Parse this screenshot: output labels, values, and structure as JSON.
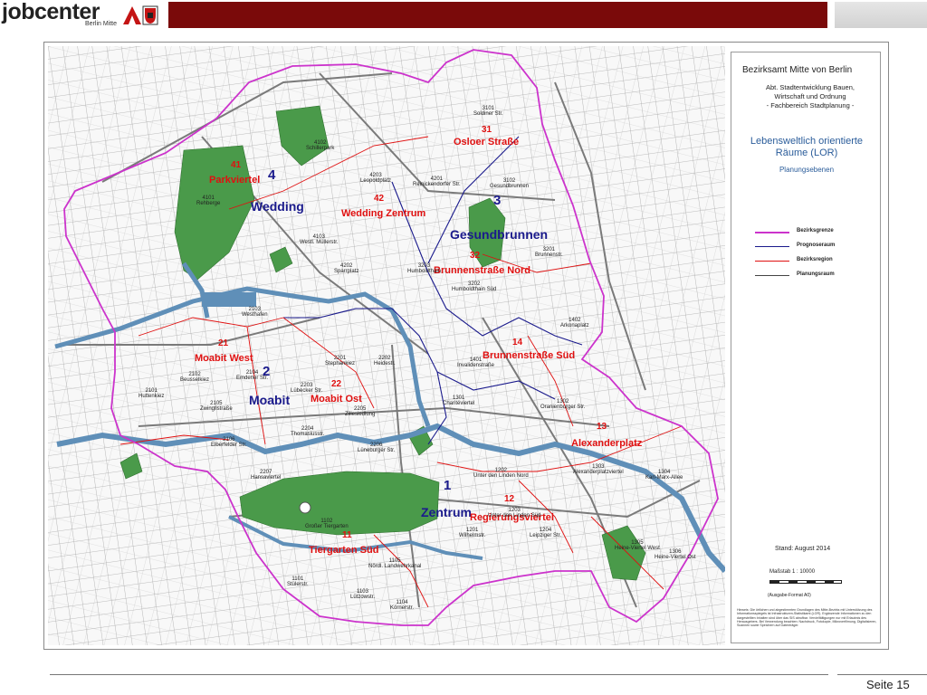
{
  "header": {
    "logo_text": "jobcenter",
    "logo_sub": "Berlin Mitte",
    "colors": {
      "bar": "#7a0a0a",
      "grey": "#d9d9d9"
    }
  },
  "legend": {
    "title": "Bezirksamt Mitte von Berlin",
    "sub_lines": [
      "Abt. Stadtentwicklung Bauen,",
      "Wirtschaft und Ordnung",
      "- Fachbereich Stadtplanung -"
    ],
    "lor_lines": [
      "Lebensweltlich orientierte",
      "Räume (LOR)"
    ],
    "ebenen": "Planungsebenen",
    "items": [
      {
        "label": "Bezirksgrenze",
        "color": "#cc33cc"
      },
      {
        "label": "Prognoseraum",
        "color": "#1a1a8c"
      },
      {
        "label": "Bezirksregion",
        "color": "#e01010"
      },
      {
        "label": "Planungsraum",
        "color": "#444444"
      }
    ],
    "stand": "Stand:   August 2014",
    "massstab": "Maßstab 1 : 10000",
    "format": "(Ausgabe-Format A0)",
    "notes": "Hinweis: Die örtlichen und abgestimmten Grundlagen des Mitte-Bezirks mit Unterstützung des Informationsspiegels ist Infrastrukturen-Statistikamt (LOR). Ergänzende Informationen zu den dargestellten Inhalten sind über das SIS abrufbar. Vervielfältigungen nur mit Erlaubnis des Herausgebers. Bei Verwendung beachten: Nachdruck, Fotokopie, Mikroverfilmung, Digitalisieren, Scannen sowie Speichern auf Datenträger."
  },
  "map": {
    "colors": {
      "park": "#4a9a4a",
      "water": "#5f8fb8",
      "street": "#9a9a9a",
      "boundary": "#cc33cc",
      "prognose": "#1a1a8c",
      "region": "#e01010"
    },
    "prognoseraeume": [
      {
        "num": "1",
        "name": "Zentrum"
      },
      {
        "num": "2",
        "name": "Moabit"
      },
      {
        "num": "3",
        "name": "Gesundbrunnen"
      },
      {
        "num": "4",
        "name": "Wedding"
      }
    ],
    "bezirksregionen": [
      {
        "num": "41",
        "name": "Parkviertel"
      },
      {
        "num": "42",
        "name": "Wedding Zentrum"
      },
      {
        "num": "31",
        "name": "Osloer Straße"
      },
      {
        "num": "32",
        "name": "Brunnenstraße Nord"
      },
      {
        "num": "21",
        "name": "Moabit West"
      },
      {
        "num": "22",
        "name": "Moabit Ost"
      },
      {
        "num": "14",
        "name": "Brunnenstraße Süd"
      },
      {
        "num": "13",
        "name": "Alexanderplatz"
      },
      {
        "num": "12",
        "name": "Regierungsviertel"
      },
      {
        "num": "11",
        "name": "Tiergarten Süd"
      }
    ],
    "planungsraeume": [
      {
        "code": "3101",
        "name": "Soldiner Str."
      },
      {
        "code": "4102",
        "name": "Schillerpark"
      },
      {
        "code": "4203",
        "name": "Leopoldplatz"
      },
      {
        "code": "4201",
        "name": "Reinickendorfer Str."
      },
      {
        "code": "3102",
        "name": "Gesundbrunnen"
      },
      {
        "code": "4101",
        "name": "Rehberge"
      },
      {
        "code": "4103",
        "name": "Westl. Müllerstr."
      },
      {
        "code": "3201",
        "name": "Brunnenstr."
      },
      {
        "code": "4202",
        "name": "Sparrplatz"
      },
      {
        "code": "3203",
        "name": "Humboldthain"
      },
      {
        "code": "3202",
        "name": "Humboldthain Süd"
      },
      {
        "code": "2103",
        "name": "Westhafen"
      },
      {
        "code": "1402",
        "name": "Arkonaplatz"
      },
      {
        "code": "2201",
        "name": "Stephankiez"
      },
      {
        "code": "2202",
        "name": "Heidestr."
      },
      {
        "code": "1401",
        "name": "Invalidenstraße"
      },
      {
        "code": "2102",
        "name": "Beusselkiez"
      },
      {
        "code": "2104",
        "name": "Emdener Str."
      },
      {
        "code": "2101",
        "name": "Huttenkiez"
      },
      {
        "code": "2203",
        "name": "Lübecker Str."
      },
      {
        "code": "2105",
        "name": "Zwinglistraße"
      },
      {
        "code": "2205",
        "name": "Zillesiedlung"
      },
      {
        "code": "1301",
        "name": "Charitéviertel"
      },
      {
        "code": "1302",
        "name": "Oranienburger Str."
      },
      {
        "code": "2204",
        "name": "Thomasiusstr."
      },
      {
        "code": "2106",
        "name": "Elberfelder Str."
      },
      {
        "code": "2206",
        "name": "Lüneburger Str."
      },
      {
        "code": "2207",
        "name": "Hansaviertel"
      },
      {
        "code": "1202",
        "name": "Unter den Linden Nord"
      },
      {
        "code": "1303",
        "name": "Alexanderplatzviertel"
      },
      {
        "code": "1304",
        "name": "Karl-Marx-Allee"
      },
      {
        "code": "1102",
        "name": "Großer Tiergarten"
      },
      {
        "code": "1203",
        "name": "Unter den Linden Süd"
      },
      {
        "code": "1201",
        "name": "Wilhelmstr."
      },
      {
        "code": "1204",
        "name": "Leipziger Str."
      },
      {
        "code": "1305",
        "name": "Heine-Viertel West"
      },
      {
        "code": "1306",
        "name": "Heine-Viertel Ost"
      },
      {
        "code": "1105",
        "name": "Nördl. Landwehrkanal"
      },
      {
        "code": "1101",
        "name": "Stülerstr."
      },
      {
        "code": "1103",
        "name": "Lützowstr."
      },
      {
        "code": "1104",
        "name": "Körnerstr."
      }
    ]
  },
  "footer": {
    "page": "Seite 15"
  }
}
